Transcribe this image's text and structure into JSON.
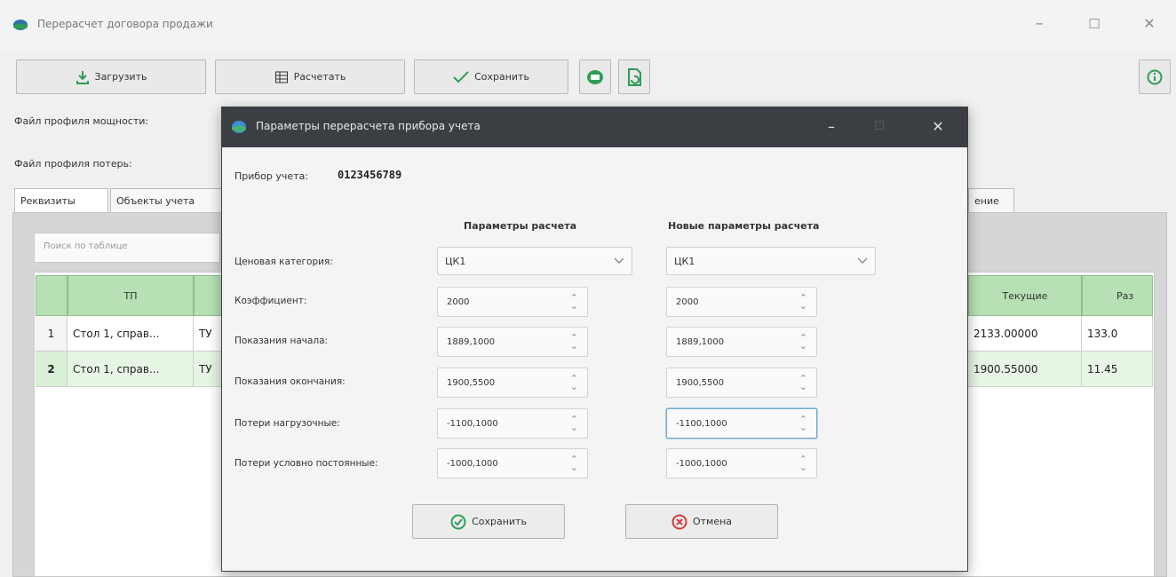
{
  "window": {
    "title": "Перерасчет договора продажи",
    "minimize": "–",
    "maximize": "☐",
    "close": "✕"
  },
  "toolbar": {
    "load_label": "Загрузить",
    "calculate_label": "Расчетать",
    "save_label": "Сохранить"
  },
  "fields": {
    "power_profile_label": "Файл профиля мощности:",
    "loss_profile_label": "Файл профиля потерь:"
  },
  "tabs": [
    "Реквизиты",
    "Объекты учета",
    "ение"
  ],
  "search": {
    "placeholder": "Поиск по таблице"
  },
  "table": {
    "headers": {
      "tp": "ТП",
      "current": "Текущие",
      "diff": "Раз"
    },
    "rows": [
      {
        "num": "1",
        "tp": "Стол 1, справ...",
        "col2": "ТУ",
        "current": "2133.00000",
        "diff": "133.0"
      },
      {
        "num": "2",
        "tp": "Стол 1, справ...",
        "col2": "ТУ",
        "current": "1900.55000",
        "diff": "11.45"
      }
    ]
  },
  "dialog": {
    "title": "Параметры перерасчета прибора учета",
    "minimize": "–",
    "maximize": "☐",
    "close": "✕",
    "meter_label": "Прибор учета:",
    "meter_value": "0123456789",
    "col_current": "Параметры расчета",
    "col_new": "Новые параметры расчета",
    "rows": [
      {
        "label": "Ценовая категория:",
        "current": "ЦК1",
        "new": "ЦК1"
      },
      {
        "label": "Коэффициент:",
        "current": "2000",
        "new": "2000"
      },
      {
        "label": "Показания начала:",
        "current": "1889,1000",
        "new": "1889,1000"
      },
      {
        "label": "Показания окончания:",
        "current": "1900,5500",
        "new": "1900,5500"
      },
      {
        "label": "Потери нагрузочные:",
        "current": "-1100,1000",
        "new": "-1100,1000"
      },
      {
        "label": "Потери условно постоянные:",
        "current": "-1000,1000",
        "new": "-1000,1000"
      }
    ],
    "save_label": "Сохранить",
    "cancel_label": "Отмена"
  },
  "colors": {
    "header_green": "#b7e0b4",
    "dialog_titlebar": "#3b3f44",
    "save_icon": "#2e9c57",
    "cancel_icon": "#d9393b",
    "load_icon": "#2e9c57"
  }
}
